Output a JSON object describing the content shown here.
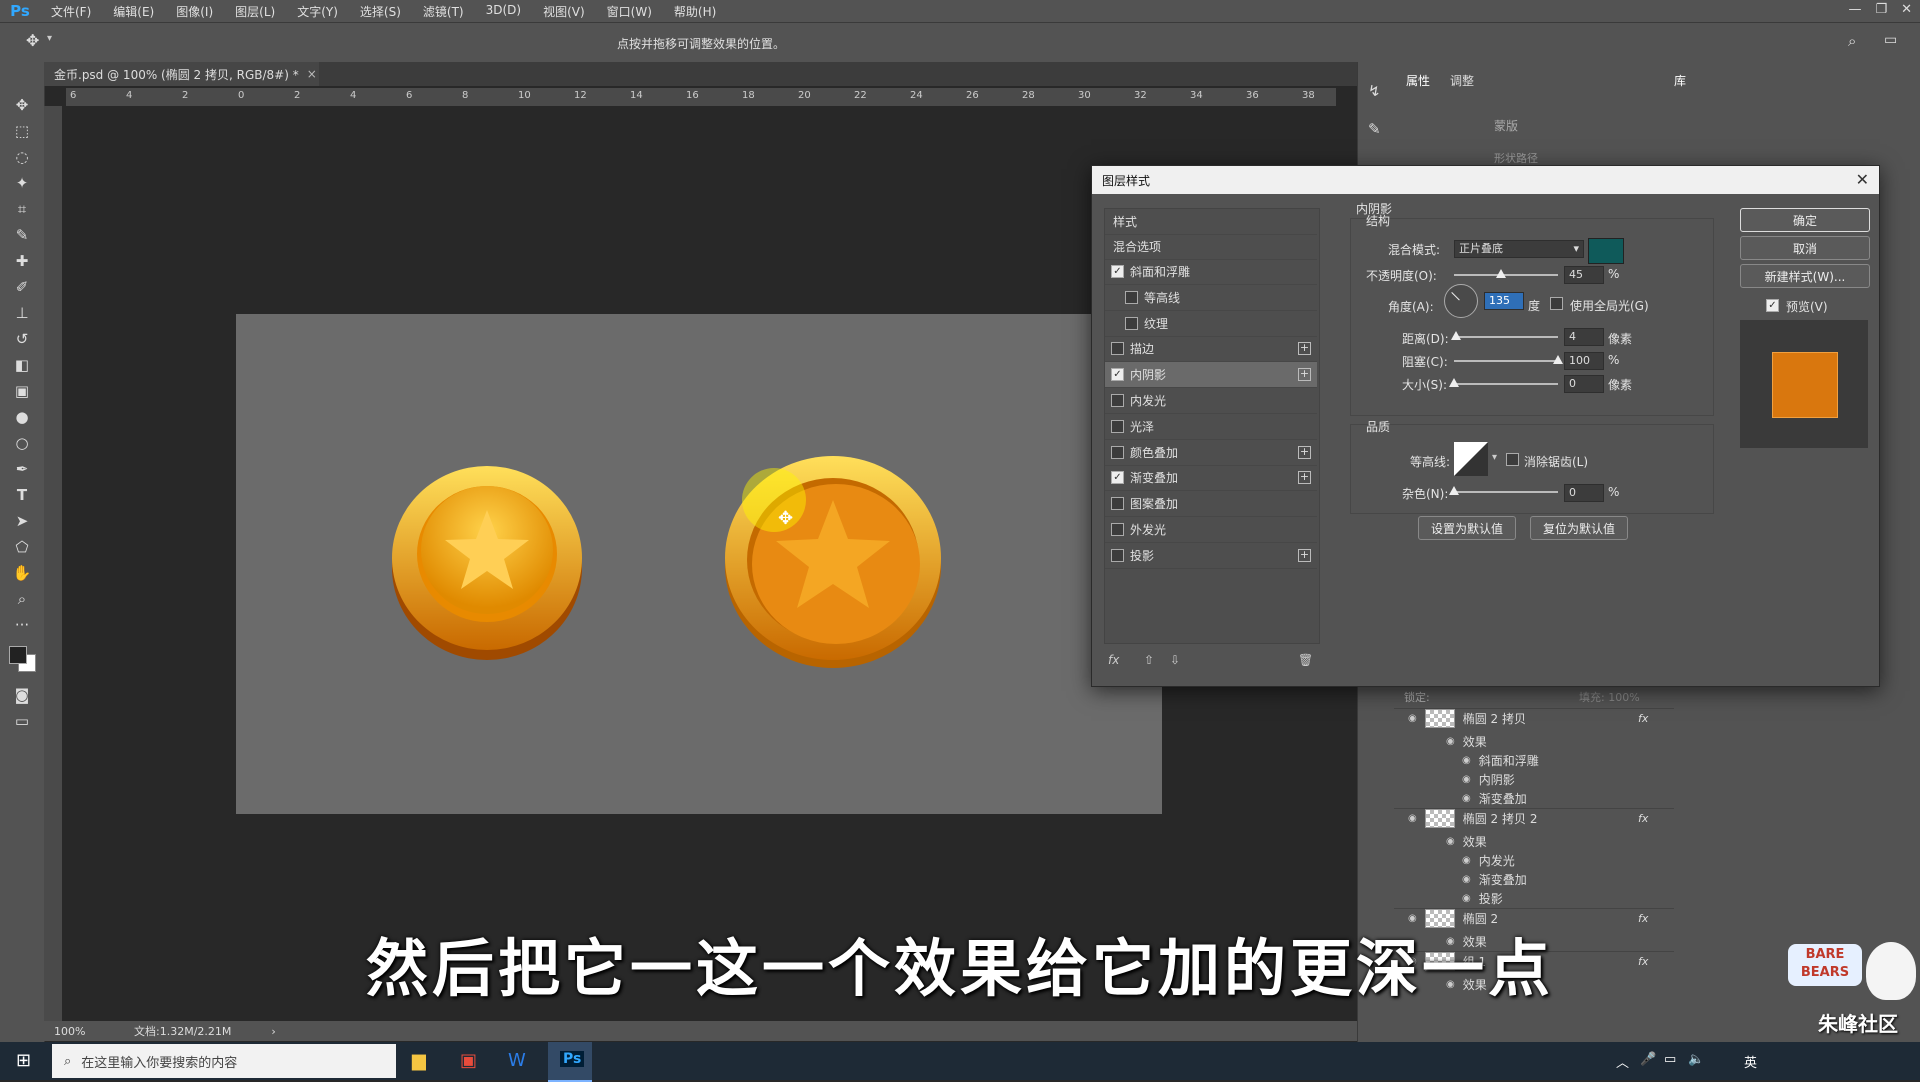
{
  "app": {
    "logo": "Ps"
  },
  "menu": [
    "文件(F)",
    "编辑(E)",
    "图像(I)",
    "图层(L)",
    "文字(Y)",
    "选择(S)",
    "滤镜(T)",
    "3D(D)",
    "视图(V)",
    "窗口(W)",
    "帮助(H)"
  ],
  "options_bar": {
    "hint": "点按并拖移可调整效果的位置。"
  },
  "document": {
    "tab_title": "金币.psd @ 100% (椭圆 2 拷贝, RGB/8#) *",
    "zoom": "100%",
    "doc_size": "文档:1.32M/2.21M"
  },
  "ruler_ticks": [
    "6",
    "4",
    "2",
    "0",
    "2",
    "4",
    "6",
    "8",
    "10",
    "12",
    "14",
    "16",
    "18",
    "20",
    "22",
    "24",
    "26",
    "28",
    "30",
    "32",
    "34",
    "36",
    "38"
  ],
  "right_panel": {
    "tabs": [
      "属性",
      "调整"
    ],
    "library_tab": "库",
    "mask_label": "蒙版",
    "mask_sub": "形状路径"
  },
  "layers": {
    "lock_label": "锁定:",
    "fill_label": "填充: 100%",
    "rows": [
      {
        "name": "椭圆 2 拷贝",
        "type": "layer",
        "fx": "fx"
      },
      {
        "name": "效果",
        "type": "effects"
      },
      {
        "name": "斜面和浮雕",
        "type": "effect"
      },
      {
        "name": "内阴影",
        "type": "effect"
      },
      {
        "name": "渐变叠加",
        "type": "effect"
      },
      {
        "name": "椭圆 2 拷贝 2",
        "type": "layer",
        "fx": "fx"
      },
      {
        "name": "效果",
        "type": "effects"
      },
      {
        "name": "内发光",
        "type": "effect"
      },
      {
        "name": "渐变叠加",
        "type": "effect"
      },
      {
        "name": "投影",
        "type": "effect"
      },
      {
        "name": "椭圆 2",
        "type": "layer",
        "fx": "fx"
      },
      {
        "name": "效果",
        "type": "effects"
      },
      {
        "name": "组 1",
        "type": "layer",
        "fx": "fx"
      },
      {
        "name": "效果",
        "type": "effects"
      }
    ]
  },
  "dialog": {
    "title": "图层样式",
    "styles_header": "样式",
    "blend_options": "混合选项",
    "style_items": [
      {
        "label": "斜面和浮雕",
        "checked": true,
        "plus": false,
        "indent": false
      },
      {
        "label": "等高线",
        "checked": false,
        "plus": false,
        "indent": true
      },
      {
        "label": "纹理",
        "checked": false,
        "plus": false,
        "indent": true
      },
      {
        "label": "描边",
        "checked": false,
        "plus": true,
        "indent": false
      },
      {
        "label": "内阴影",
        "checked": true,
        "plus": true,
        "indent": false,
        "selected": true
      },
      {
        "label": "内发光",
        "checked": false,
        "plus": false,
        "indent": false
      },
      {
        "label": "光泽",
        "checked": false,
        "plus": false,
        "indent": false
      },
      {
        "label": "颜色叠加",
        "checked": false,
        "plus": true,
        "indent": false
      },
      {
        "label": "渐变叠加",
        "checked": true,
        "plus": true,
        "indent": false
      },
      {
        "label": "图案叠加",
        "checked": false,
        "plus": false,
        "indent": false
      },
      {
        "label": "外发光",
        "checked": false,
        "plus": false,
        "indent": false
      },
      {
        "label": "投影",
        "checked": false,
        "plus": true,
        "indent": false
      }
    ],
    "fx_label": "fx",
    "section_title": "内阴影",
    "structure_title": "结构",
    "blend_mode_label": "混合模式:",
    "blend_mode_value": "正片叠底",
    "shadow_color": "#0f5a5a",
    "opacity_label": "不透明度(O):",
    "opacity_value": "45",
    "opacity_pct": 45,
    "percent": "%",
    "angle_label": "角度(A):",
    "angle_value": "135",
    "angle_unit": "度",
    "global_light_label": "使用全局光(G)",
    "distance_label": "距离(D):",
    "distance_value": "4",
    "distance_pct": 2,
    "pixel_unit": "像素",
    "choke_label": "阻塞(C):",
    "choke_value": "100",
    "choke_pct": 100,
    "size_label": "大小(S):",
    "size_value": "0",
    "size_pct": 0,
    "quality_title": "品质",
    "contour_label": "等高线:",
    "antialias_label": "消除锯齿(L)",
    "noise_label": "杂色(N):",
    "noise_value": "0",
    "noise_pct": 0,
    "set_default_button": "设置为默认值",
    "reset_default_button": "复位为默认值",
    "ok_button": "确定",
    "cancel_button": "取消",
    "new_style_button": "新建样式(W)...",
    "preview_label": "预览(V)",
    "preview_color": "#d9770e"
  },
  "subtitle": "然后把它一这一个效果给它加的更深一点",
  "taskbar": {
    "search_placeholder": "在这里输入你要搜索的内容",
    "ime": "英"
  },
  "watermark": {
    "badge": "BARE BEARS",
    "site": "朱峰社区"
  }
}
